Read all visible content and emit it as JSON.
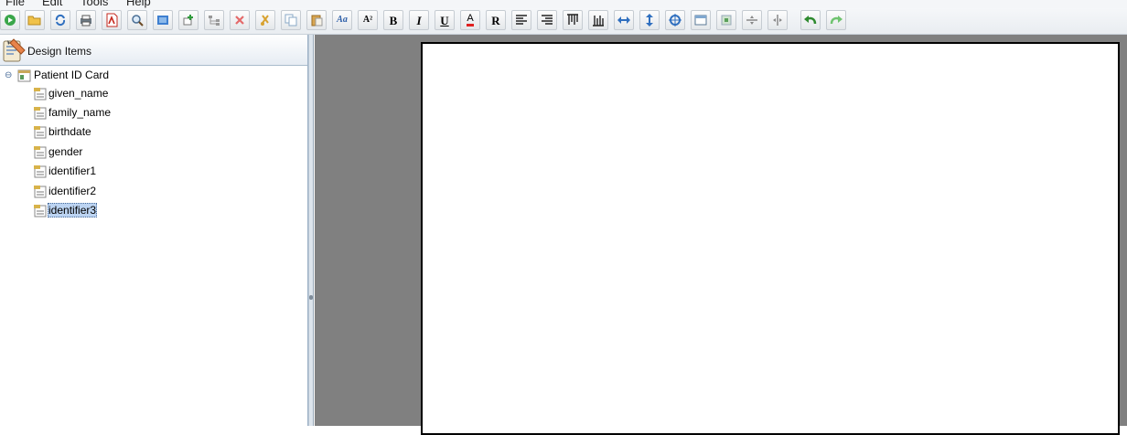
{
  "menu": {
    "items": [
      {
        "label": "File"
      },
      {
        "label": "Edit"
      },
      {
        "label": "Tools"
      },
      {
        "label": "Help"
      }
    ]
  },
  "toolbar": {
    "buttons": [
      {
        "icon": "go-icon"
      },
      {
        "icon": "open-folder-icon"
      },
      {
        "icon": "refresh-icon"
      },
      {
        "icon": "print-icon"
      },
      {
        "icon": "pdf-icon"
      },
      {
        "icon": "zoom-icon"
      },
      {
        "icon": "frame-icon"
      },
      {
        "icon": "add-item-icon"
      },
      {
        "icon": "hierarchy-icon"
      },
      {
        "icon": "delete-icon"
      },
      {
        "icon": "cut-icon"
      },
      {
        "icon": "copy-icon"
      },
      {
        "icon": "paste-icon"
      },
      {
        "icon": "font-icon",
        "text": "Aa"
      },
      {
        "icon": "font-size-icon",
        "text": "A²"
      },
      {
        "icon": "bold-icon",
        "text": "B"
      },
      {
        "icon": "italic-icon",
        "text": "I"
      },
      {
        "icon": "underline-icon",
        "text": "U"
      },
      {
        "icon": "font-color-icon",
        "text": "A"
      },
      {
        "icon": "reset-icon",
        "text": "R"
      },
      {
        "icon": "align-left-icon"
      },
      {
        "icon": "align-right-icon"
      },
      {
        "icon": "align-top-icon"
      },
      {
        "icon": "align-bottom-icon"
      },
      {
        "icon": "same-width-icon"
      },
      {
        "icon": "same-height-icon"
      },
      {
        "icon": "center-icon"
      },
      {
        "icon": "window-icon"
      },
      {
        "icon": "box-icon"
      },
      {
        "icon": "horizontal-divide-icon"
      },
      {
        "icon": "vertical-divide-icon"
      },
      {
        "icon": "undo-icon"
      },
      {
        "icon": "redo-icon"
      }
    ]
  },
  "panel": {
    "title": "Design Items",
    "tree": {
      "root": {
        "label": "Patient ID Card",
        "expander": "⊖"
      },
      "children": [
        {
          "label": "given_name",
          "selected": false
        },
        {
          "label": "family_name",
          "selected": false
        },
        {
          "label": "birthdate",
          "selected": false
        },
        {
          "label": "gender",
          "selected": false
        },
        {
          "label": "identifier1",
          "selected": false
        },
        {
          "label": "identifier2",
          "selected": false
        },
        {
          "label": "identifier3",
          "selected": true
        }
      ]
    }
  },
  "colors": {
    "canvas_background": "#808080",
    "selection": "#bcd4f2",
    "page": "#ffffff"
  }
}
